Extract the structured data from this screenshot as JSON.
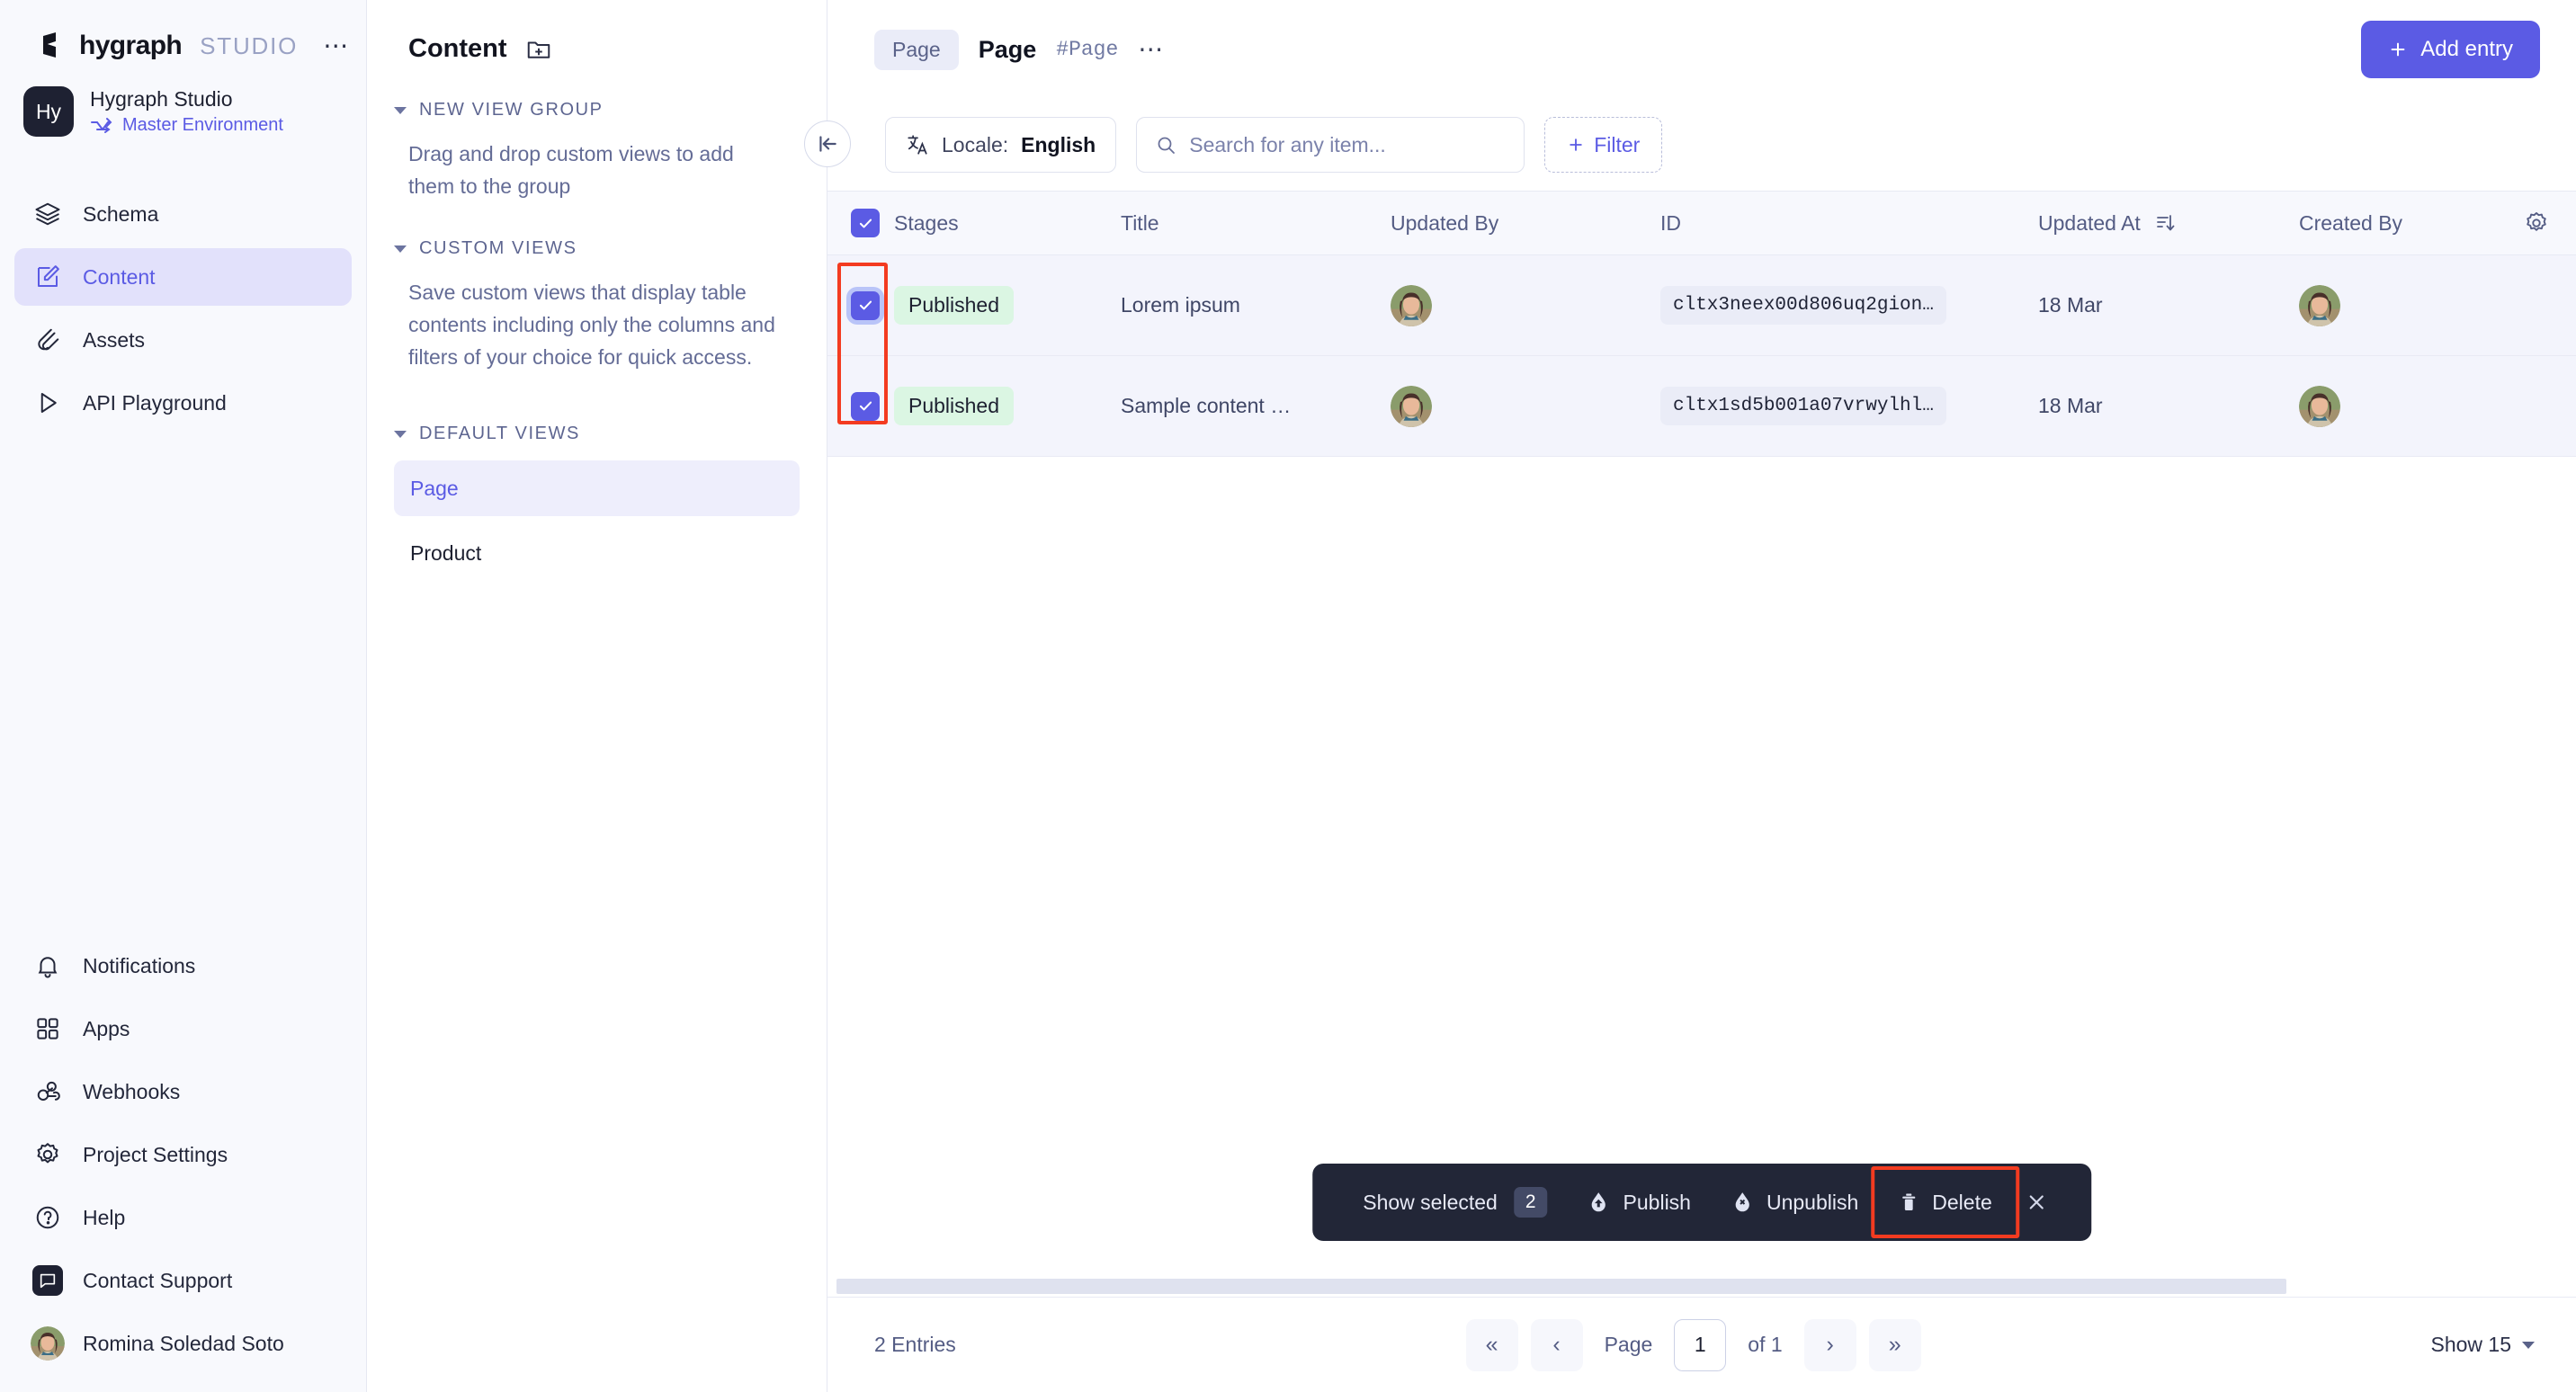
{
  "brand": {
    "name": "hygraph",
    "suffix": "STUDIO",
    "menu_dots": "⋯"
  },
  "project": {
    "initials": "Hy",
    "name": "Hygraph Studio",
    "environment": "Master Environment"
  },
  "sidebar": {
    "items": [
      {
        "label": "Schema",
        "icon": "layers-icon",
        "active": false
      },
      {
        "label": "Content",
        "icon": "edit-square-icon",
        "active": true
      },
      {
        "label": "Assets",
        "icon": "paperclip-icon",
        "active": false
      },
      {
        "label": "API Playground",
        "icon": "play-icon",
        "active": false
      }
    ],
    "bottom_items": [
      {
        "label": "Notifications",
        "icon": "bell-icon"
      },
      {
        "label": "Apps",
        "icon": "grid-icon"
      },
      {
        "label": "Webhooks",
        "icon": "webhook-icon"
      },
      {
        "label": "Project Settings",
        "icon": "gear-icon"
      },
      {
        "label": "Help",
        "icon": "question-circle-icon"
      },
      {
        "label": "Contact Support",
        "icon": "chat-icon"
      }
    ],
    "user": {
      "name": "Romina Soledad Soto",
      "avatar": "user-avatar"
    }
  },
  "views_panel": {
    "title": "Content",
    "add_icon": "folder-plus-icon",
    "sections": [
      {
        "heading": "NEW VIEW GROUP",
        "description": "Drag and drop custom views to add them to the group",
        "items": []
      },
      {
        "heading": "CUSTOM VIEWS",
        "description": "Save custom views that display table contents including only the columns and filters of your choice for quick access.",
        "items": []
      },
      {
        "heading": "DEFAULT VIEWS",
        "description": "",
        "items": [
          {
            "label": "Page",
            "active": true
          },
          {
            "label": "Product",
            "active": false
          }
        ]
      }
    ]
  },
  "topbar": {
    "breadcrumb_chip": "Page",
    "title": "Page",
    "hash": "#Page",
    "more_dots": "⋯",
    "add_entry": "Add entry",
    "add_entry_icon": "plus-icon"
  },
  "filterbar": {
    "collapse_icon": "collapse-left-icon",
    "locale_icon": "translate-icon",
    "locale_label": "Locale:",
    "locale_value": "English",
    "search_icon": "search-icon",
    "search_placeholder": "Search for any item...",
    "search_value": "",
    "filter_label": "Filter",
    "filter_icon": "plus-icon"
  },
  "table": {
    "select_all_checked": true,
    "columns": [
      {
        "key": "stages",
        "label": "Stages"
      },
      {
        "key": "title",
        "label": "Title"
      },
      {
        "key": "updated_by",
        "label": "Updated By"
      },
      {
        "key": "id",
        "label": "ID"
      },
      {
        "key": "updated_at",
        "label": "Updated At",
        "sort_icon": "sort-desc-icon"
      },
      {
        "key": "created_by",
        "label": "Created By"
      }
    ],
    "settings_icon": "gear-icon",
    "rows": [
      {
        "checked": true,
        "stage": "Published",
        "title": "Lorem ipsum",
        "updated_by": "user-avatar",
        "id": "cltx3neex00d806uq2gion…",
        "updated_at": "18 Mar",
        "created_by": "user-avatar"
      },
      {
        "checked": true,
        "stage": "Published",
        "title": "Sample content …",
        "updated_by": "user-avatar",
        "id": "cltx1sd5b001a07vrwylhl…",
        "updated_at": "18 Mar",
        "created_by": "user-avatar"
      }
    ]
  },
  "action_bar": {
    "show_selected_label": "Show selected",
    "selected_count": "2",
    "publish_label": "Publish",
    "publish_icon": "publish-icon",
    "unpublish_label": "Unpublish",
    "unpublish_icon": "unpublish-icon",
    "delete_label": "Delete",
    "delete_icon": "trash-icon",
    "close_icon": "close-icon"
  },
  "footer": {
    "entries": "2 Entries",
    "first_icon": "«",
    "prev_icon": "‹",
    "page_label": "Page",
    "page_value": "1",
    "of_label": "of 1",
    "next_icon": "›",
    "last_icon": "»",
    "show_label": "Show 15"
  },
  "highlights": {
    "checkbox_column": "red-highlight-box",
    "delete_button": "red-highlight-box"
  },
  "colors": {
    "accent": "#5b5be4",
    "highlight": "#f33b20",
    "published_badge_bg": "#dbf6e3",
    "dark": "#222637"
  }
}
